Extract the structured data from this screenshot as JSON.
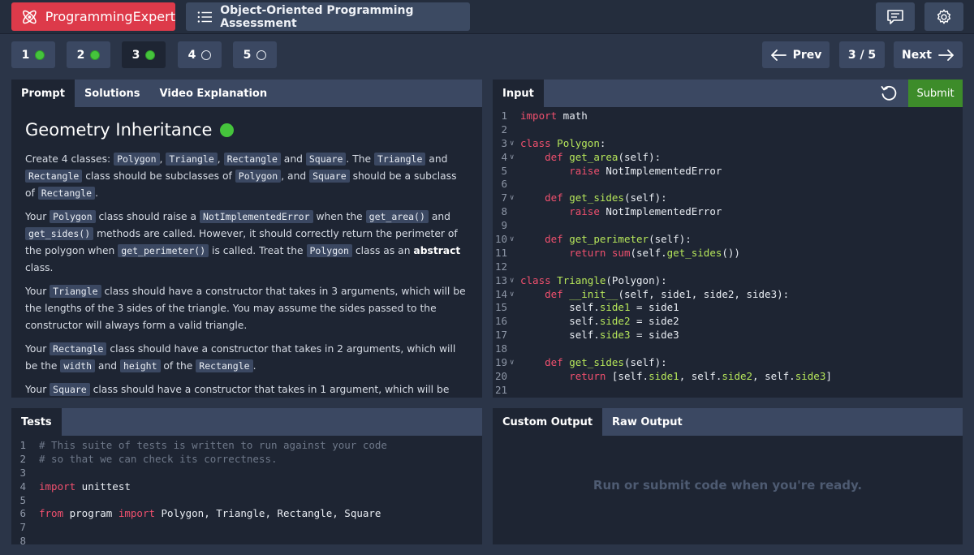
{
  "topbar": {
    "brand": "ProgrammingExpert",
    "assessment_title": "Object-Oriented Programming Assessment",
    "icons": [
      "atom-logo-icon",
      "list-icon",
      "feedback-icon",
      "gear-icon"
    ]
  },
  "questions": [
    {
      "number": "1",
      "status": "complete"
    },
    {
      "number": "2",
      "status": "complete"
    },
    {
      "number": "3",
      "status": "complete",
      "active": true
    },
    {
      "number": "4",
      "status": "incomplete"
    },
    {
      "number": "5",
      "status": "incomplete"
    }
  ],
  "nav": {
    "prev": "Prev",
    "counter": "3 / 5",
    "next": "Next"
  },
  "prompt_panel": {
    "tabs": [
      "Prompt",
      "Solutions",
      "Video Explanation"
    ],
    "title": "Geometry Inheritance"
  },
  "input_panel": {
    "tab": "Input",
    "submit": "Submit"
  },
  "input_code": [
    {
      "n": "1",
      "fold": false,
      "html": "<span class='kw'>import</span> math"
    },
    {
      "n": "2",
      "fold": false,
      "html": ""
    },
    {
      "n": "3",
      "fold": true,
      "html": "<span class='kw'>class</span> <span class='fn'>Polygon</span>:"
    },
    {
      "n": "4",
      "fold": true,
      "html": "    <span class='kw'>def</span> <span class='fn'>get_area</span>(self):"
    },
    {
      "n": "5",
      "fold": false,
      "html": "        <span class='kw'>raise</span> NotImplementedError"
    },
    {
      "n": "6",
      "fold": false,
      "html": ""
    },
    {
      "n": "7",
      "fold": true,
      "html": "    <span class='kw'>def</span> <span class='fn'>get_sides</span>(self):"
    },
    {
      "n": "8",
      "fold": false,
      "html": "        <span class='kw'>raise</span> NotImplementedError"
    },
    {
      "n": "9",
      "fold": false,
      "html": ""
    },
    {
      "n": "10",
      "fold": true,
      "html": "    <span class='kw'>def</span> <span class='fn'>get_perimeter</span>(self):"
    },
    {
      "n": "11",
      "fold": false,
      "html": "        <span class='kw'>return</span> <span class='kw'>sum</span>(self.<span class='fn'>get_sides</span>())"
    },
    {
      "n": "12",
      "fold": false,
      "html": ""
    },
    {
      "n": "13",
      "fold": true,
      "html": "<span class='kw'>class</span> <span class='fn'>Triangle</span>(Polygon):"
    },
    {
      "n": "14",
      "fold": true,
      "html": "    <span class='kw'>def</span> <span class='fn'>__init__</span>(self, side1, side2, side3):"
    },
    {
      "n": "15",
      "fold": false,
      "html": "        self.<span class='fn'>side1</span> = side1"
    },
    {
      "n": "16",
      "fold": false,
      "html": "        self.<span class='fn'>side2</span> = side2"
    },
    {
      "n": "17",
      "fold": false,
      "html": "        self.<span class='fn'>side3</span> = side3"
    },
    {
      "n": "18",
      "fold": false,
      "html": ""
    },
    {
      "n": "19",
      "fold": true,
      "html": "    <span class='kw'>def</span> <span class='fn'>get_sides</span>(self):"
    },
    {
      "n": "20",
      "fold": false,
      "html": "        <span class='kw'>return</span> [self.<span class='fn'>side1</span>, self.<span class='fn'>side2</span>, self.<span class='fn'>side3</span>]"
    },
    {
      "n": "21",
      "fold": false,
      "html": ""
    }
  ],
  "tests_panel": {
    "tab": "Tests"
  },
  "tests_code": [
    {
      "n": "1",
      "html": "<span class='cm'># This suite of tests is written to run against your code</span>"
    },
    {
      "n": "2",
      "html": "<span class='cm'># so that we can check its correctness.</span>"
    },
    {
      "n": "3",
      "html": ""
    },
    {
      "n": "4",
      "html": "<span class='kw'>import</span> unittest"
    },
    {
      "n": "5",
      "html": ""
    },
    {
      "n": "6",
      "html": "<span class='kw'>from</span> program <span class='kw'>import</span> Polygon, Triangle, Rectangle, Square"
    },
    {
      "n": "7",
      "html": ""
    },
    {
      "n": "8",
      "html": ""
    }
  ],
  "output_panel": {
    "tabs": [
      "Custom Output",
      "Raw Output"
    ],
    "message": "Run or submit code when you're ready."
  },
  "colors": {
    "brand": "#dd3a4a",
    "complete": "#45c43c",
    "submit": "#3d8c2a",
    "keyword": "#f0506e",
    "identifier": "#b6e65a"
  }
}
